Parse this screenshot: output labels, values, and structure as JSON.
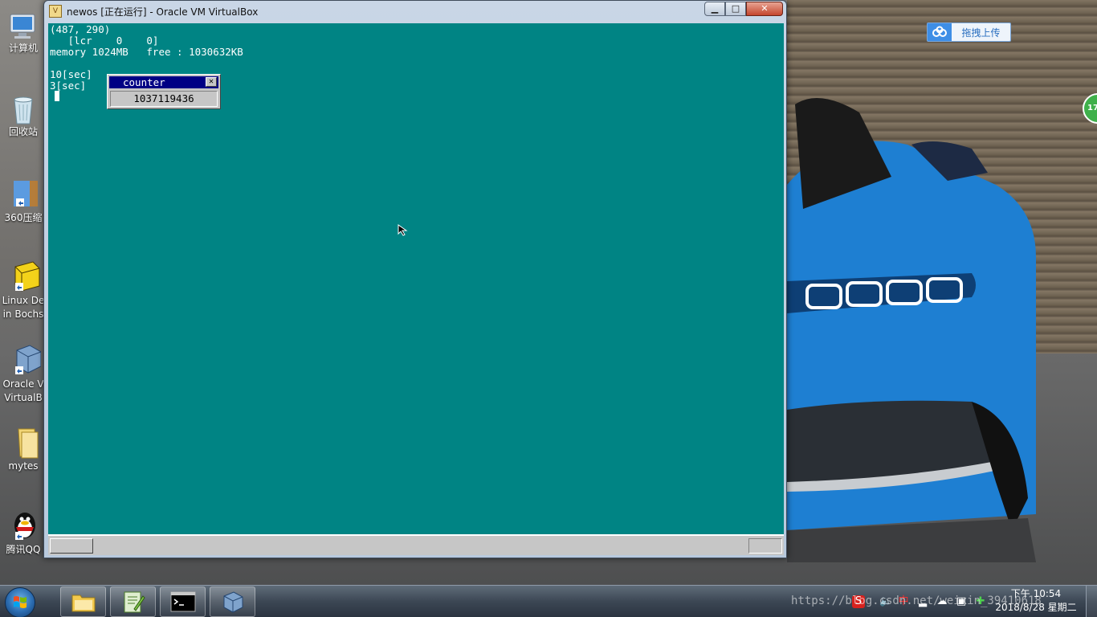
{
  "desktop": {
    "icons": [
      {
        "label1": "计算机",
        "label2": ""
      },
      {
        "label1": "回收站",
        "label2": ""
      },
      {
        "label1": "360压缩",
        "label2": ""
      },
      {
        "label1": "Linux De",
        "label2": "in Bochs"
      },
      {
        "label1": "Oracle V",
        "label2": "VirtualB"
      },
      {
        "label1": "mytes",
        "label2": ""
      },
      {
        "label1": "腾讯QQ",
        "label2": ""
      }
    ],
    "upload_widget": {
      "label": "拖拽上传"
    },
    "badge": {
      "value": "17"
    }
  },
  "vbox": {
    "title": "newos [正在运行] - Oracle VM VirtualBox",
    "controls": {
      "minimize": "▁",
      "maximize": "□",
      "close": "✕"
    },
    "guest": {
      "mouse_pos": "(487, 290)",
      "mouse_buttons": "   [lcr    0    0]",
      "memory": "memory 1024MB   free : 1030632KB",
      "timer_10": "10[sec]",
      "timer_3": "3[sec]",
      "counter_window": {
        "title": "counter",
        "close": "✕",
        "value": "1037119436"
      }
    }
  },
  "taskbar": {
    "apps": [
      "file-explorer",
      "notepad-plus-plus",
      "command-prompt",
      "virtualbox"
    ],
    "tray": {
      "ime": "中"
    },
    "clock": {
      "time": "下午 10:54",
      "date": "2018/8/28 星期二"
    },
    "watermark": "https://blog.csdn.net/weixin_39410618"
  }
}
